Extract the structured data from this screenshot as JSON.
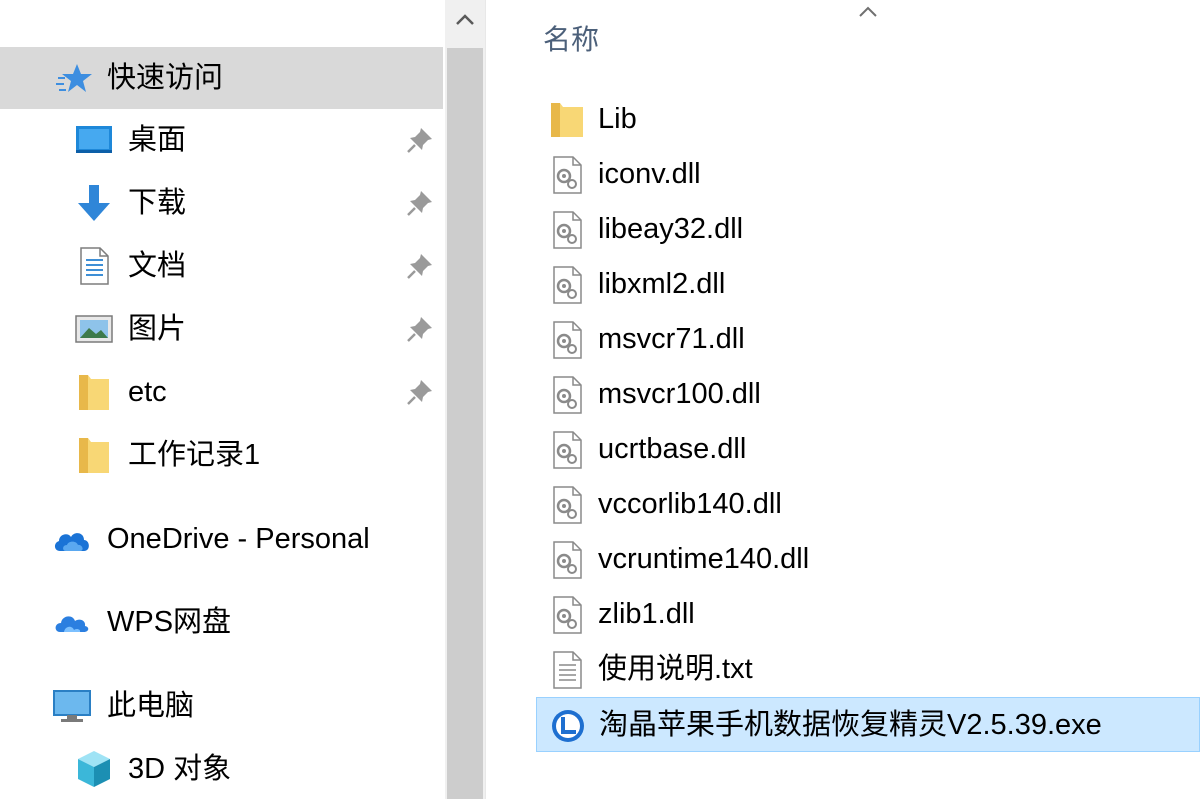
{
  "nav": {
    "quick_access": "快速访问",
    "pinned": [
      {
        "label": "桌面",
        "icon": "desktop-icon"
      },
      {
        "label": "下载",
        "icon": "download-icon"
      },
      {
        "label": "文档",
        "icon": "document-icon"
      },
      {
        "label": "图片",
        "icon": "pictures-icon"
      },
      {
        "label": "etc",
        "icon": "folder-icon"
      }
    ],
    "recent": [
      {
        "label": "工作记录1",
        "icon": "folder-icon"
      }
    ],
    "onedrive": "OneDrive - Personal",
    "wps": "WPS网盘",
    "this_pc": "此电脑",
    "objects_3d": "3D 对象"
  },
  "list": {
    "column_name": "名称",
    "files": [
      {
        "name": "Lib",
        "type": "folder",
        "selected": false
      },
      {
        "name": "iconv.dll",
        "type": "dll",
        "selected": false
      },
      {
        "name": "libeay32.dll",
        "type": "dll",
        "selected": false
      },
      {
        "name": "libxml2.dll",
        "type": "dll",
        "selected": false
      },
      {
        "name": "msvcr71.dll",
        "type": "dll",
        "selected": false
      },
      {
        "name": "msvcr100.dll",
        "type": "dll",
        "selected": false
      },
      {
        "name": "ucrtbase.dll",
        "type": "dll",
        "selected": false
      },
      {
        "name": "vccorlib140.dll",
        "type": "dll",
        "selected": false
      },
      {
        "name": "vcruntime140.dll",
        "type": "dll",
        "selected": false
      },
      {
        "name": "zlib1.dll",
        "type": "dll",
        "selected": false
      },
      {
        "name": "使用说明.txt",
        "type": "txt",
        "selected": false
      },
      {
        "name": "淘晶苹果手机数据恢复精灵V2.5.39.exe",
        "type": "exe",
        "selected": true
      }
    ]
  },
  "colors": {
    "selection_bg": "#cce8ff",
    "selection_border": "#99d1ff",
    "quick_access_bg": "#d9d9d9",
    "header_text": "#4c607a"
  }
}
